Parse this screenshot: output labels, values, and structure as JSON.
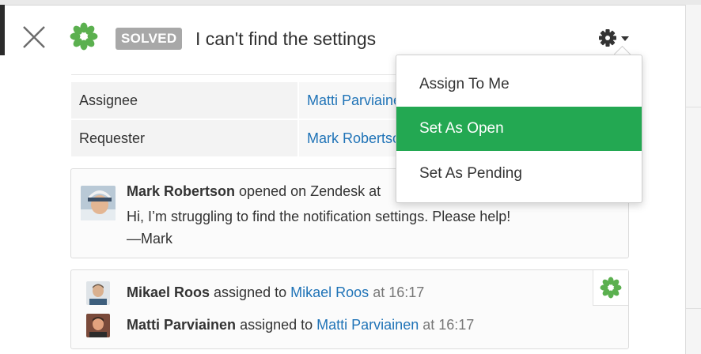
{
  "ticket": {
    "status": "SOLVED",
    "title": "I can't find the settings"
  },
  "properties": [
    {
      "label": "Assignee",
      "value": "Matti Parviainen"
    },
    {
      "label": "Requester",
      "value": "Mark Robertson"
    }
  ],
  "comment": {
    "author": "Mark Robertson",
    "action": "opened on Zendesk at",
    "lines": [
      "Hi, I’m struggling to find the notification settings. Please help!",
      "—Mark"
    ]
  },
  "events": [
    {
      "actor": "Mikael Roos",
      "action": "assigned to",
      "target": "Mikael Roos",
      "time": "at 16:17"
    },
    {
      "actor": "Matti Parviainen",
      "action": "assigned to",
      "target": "Matti Parviainen",
      "time": "at 16:17"
    }
  ],
  "dropdown": {
    "items": [
      "Assign To Me",
      "Set As Open",
      "Set As Pending"
    ],
    "active_index": 1
  },
  "icons": {
    "close": "close-icon",
    "logo": "zendesk-flower-logo-icon",
    "gear": "gear-icon",
    "caret": "caret-down-icon",
    "channel": "zendesk-flower-channel-icon"
  },
  "colors": {
    "link": "#1f73b7",
    "menu_active": "#23a852",
    "badge": "#a8a8a8",
    "logo_green": "#5bb04f"
  }
}
